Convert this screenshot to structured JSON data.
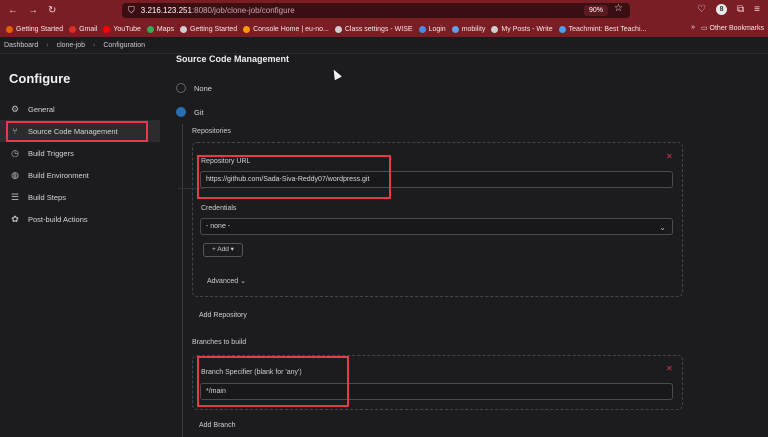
{
  "browser": {
    "nav_back": "←",
    "nav_forward": "→",
    "nav_reload": "↻",
    "url_host": "3.216.123.251",
    "url_path": ":8080/job/clone-job/configure",
    "zoom": "90%",
    "star": "☆",
    "account_initial": "8"
  },
  "bookmarks": [
    {
      "label": "Getting Started",
      "color": "#e66000"
    },
    {
      "label": "Gmail",
      "color": "#d93025"
    },
    {
      "label": "YouTube",
      "color": "#ff0000"
    },
    {
      "label": "Maps",
      "color": "#34a853"
    },
    {
      "label": "Getting Started",
      "color": "#cfcfcf"
    },
    {
      "label": "Console Home | eu-no...",
      "color": "#ff9900"
    },
    {
      "label": "Class settings - WISE",
      "color": "#cfcfcf"
    },
    {
      "label": "Login",
      "color": "#4a8ae8"
    },
    {
      "label": "mobility",
      "color": "#5fa0e8"
    },
    {
      "label": "My Posts - Write",
      "color": "#cfcfcf"
    },
    {
      "label": "Teachmint: Best Teachi...",
      "color": "#4aa0f0"
    }
  ],
  "bookmarks_more": "»",
  "other_bookmarks": "Other Bookmarks",
  "breadcrumbs": [
    "Dashboard",
    "clone-job",
    "Configuration"
  ],
  "breadcrumb_sep": "›",
  "sidebar": {
    "title": "Configure",
    "items": [
      {
        "label": "General",
        "icon": "⚙"
      },
      {
        "label": "Source Code Management",
        "icon": "⑂"
      },
      {
        "label": "Build Triggers",
        "icon": "◷"
      },
      {
        "label": "Build Environment",
        "icon": "◍"
      },
      {
        "label": "Build Steps",
        "icon": "☰"
      },
      {
        "label": "Post-build Actions",
        "icon": "✿"
      }
    ]
  },
  "scm": {
    "title": "Source Code Management",
    "option_none": "None",
    "option_git": "Git",
    "repositories_label": "Repositories",
    "repo_url_label": "Repository URL",
    "repo_url_value": "https://github.com/Sada-Siva-Reddy07/wordpress.git",
    "credentials_label": "Credentials",
    "credentials_value": "- none -",
    "add_button": "+ Add ▾",
    "advanced": "Advanced",
    "advanced_chevron": "⌄",
    "add_repository": "Add Repository",
    "branches_label": "Branches to build",
    "branch_spec_label": "Branch Specifier (blank for 'any')",
    "branch_spec_value": "*/main",
    "add_branch": "Add Branch",
    "remove_icon": "✕",
    "select_chevron": "⌄"
  },
  "colors": {
    "browser_chrome": "#7a1d24",
    "highlight_box": "#e53b48",
    "radio_selected": "#2b6fb0"
  }
}
